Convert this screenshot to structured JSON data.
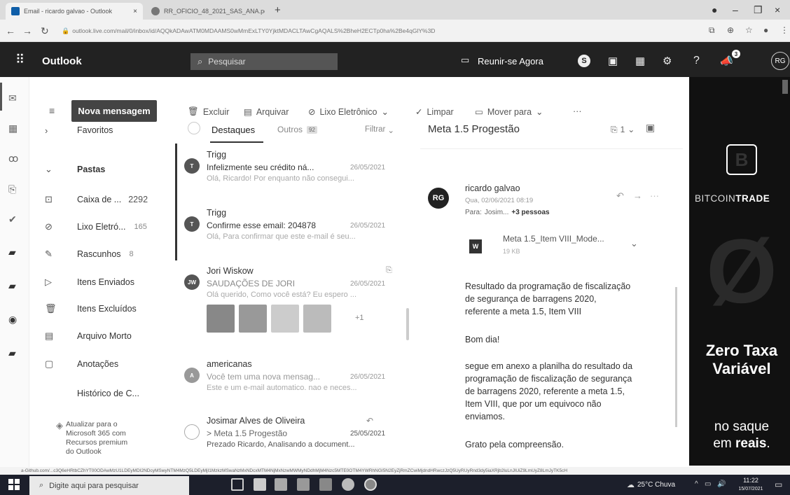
{
  "browser": {
    "tabs": [
      {
        "label": "Email - ricardo galvao - Outlook"
      },
      {
        "label": "RR_OFICIO_48_2021_SAS_ANA.pdf"
      }
    ],
    "url": "outlook.live.com/mail/0/inbox/id/AQQkADAwATM0MDAAMS0wMmExLTY0YjktMDACLTAwCgAQALS%2BheH2ECTp0ha%2Be4qGlY%3D",
    "status_url": "a-Github.com/...c3Q6eHRtbCZhYT00ODAwMzU1LDEyMDI2NDcyMSwyNTM4MzQ5LDEyMjI1MzkzMSwaNzMxNDcxMTM4NjMxNzwMWMyNDdhMjM4Nzc5MTE0OTM4YWRhNGI5N2EyZjRmZCwiMjdndHRwczJzQ5UyRUyRnd3dy5iaXRjb2luLnJlUiZ9LmUyZ8LmJyTK5cH"
  },
  "header": {
    "app_name": "Outlook",
    "search_placeholder": "Pesquisar",
    "meet_now": "Reunir-se Agora",
    "notif_count": "3",
    "avatar": "RG"
  },
  "folders": {
    "new_message": "Nova mensagem",
    "favorites": "Favoritos",
    "folders_title": "Pastas",
    "items": [
      {
        "label": "Caixa de ...",
        "count": "2292"
      },
      {
        "label": "Lixo Eletró...",
        "count": "165"
      },
      {
        "label": "Rascunhos",
        "count": "8"
      },
      {
        "label": "Itens Enviados",
        "count": ""
      },
      {
        "label": "Itens Excluídos",
        "count": ""
      },
      {
        "label": "Arquivo Morto",
        "count": ""
      },
      {
        "label": "Anotações",
        "count": ""
      },
      {
        "label": "Histórico de C...",
        "count": ""
      }
    ],
    "upgrade": "Atualizar para o Microsoft 365 com Recursos premium do Outlook"
  },
  "toolbar": {
    "delete": "Excluir",
    "archive": "Arquivar",
    "junk": "Lixo Eletrônico",
    "sweep": "Limpar",
    "move": "Mover para",
    "more": "···"
  },
  "list": {
    "focused": "Destaques",
    "other": "Outros",
    "other_count": "92",
    "filter": "Filtrar",
    "messages": [
      {
        "avatar": "T",
        "from": "Trigg",
        "subject": "Infelizmente seu crédito ná...",
        "date": "26/05/2021",
        "preview": "Olá, Ricardo! Por enquanto não consegui..."
      },
      {
        "avatar": "T",
        "from": "Trigg",
        "subject": "Confirme esse email: 204878",
        "date": "26/05/2021",
        "preview": "Olá, Para confirmar que este e-mail é seu..."
      },
      {
        "avatar": "JW",
        "from": "Jori Wiskow",
        "subject": "SAUDAÇÕES DE JORI",
        "date": "26/05/2021",
        "preview": "Olá querido, Como você está? Eu espero ...",
        "more": "+1"
      },
      {
        "avatar": "A",
        "from": "americanas",
        "subject": "Você tem uma nova mensag...",
        "date": "26/05/2021",
        "preview": "Este e um e-mail automatico. nao e neces..."
      },
      {
        "avatar": "",
        "from": "Josimar Alves de Oliveira",
        "subject": "> Meta 1.5 Progestão",
        "date": "25/05/2021",
        "preview": "Prezado Ricardo, Analisando a document..."
      }
    ]
  },
  "reading": {
    "title": "Meta 1.5 Progestão",
    "attach_count": "1",
    "sender_avatar": "RG",
    "sender": "ricardo galvao",
    "sent": "Qua, 02/06/2021 08:19",
    "to_label": "Para:",
    "to_name": "Josim...",
    "to_more": "+3 pessoas",
    "attachment_name": "Meta 1.5_Item VIII_Mode...",
    "attachment_size": "19 KB",
    "body": [
      "Resultado da programação de fiscalização de segurança de barragens 2020, referente a meta 1.5, Item VIII",
      "Bom dia!",
      "segue em anexo a planilha do resultado da programação de fiscalização de segurança de barragens 2020, referente a meta 1.5, Item VIII, que por um equivoco não enviamos.",
      "Grato pela compreensão."
    ]
  },
  "ad": {
    "brand_prefix": "BITCOIN",
    "brand_suffix": "TRADE",
    "logo_letter": "B",
    "big_glyph": "Ø",
    "headline": "Zero Taxa Variável",
    "tagline_start": "no saque",
    "tagline_mid": "em ",
    "tagline_bold": "reais",
    "tagline_end": "."
  },
  "taskbar": {
    "search_placeholder": "Digite aqui para pesquisar",
    "weather": "25°C Chuva",
    "time": "11:22",
    "date": "15/07/2021"
  },
  "colors": {
    "header_bg": "#222222",
    "new_message_bg": "#444444",
    "ad_bg": "#111111",
    "taskbar_bg": "#1c1f2b"
  }
}
